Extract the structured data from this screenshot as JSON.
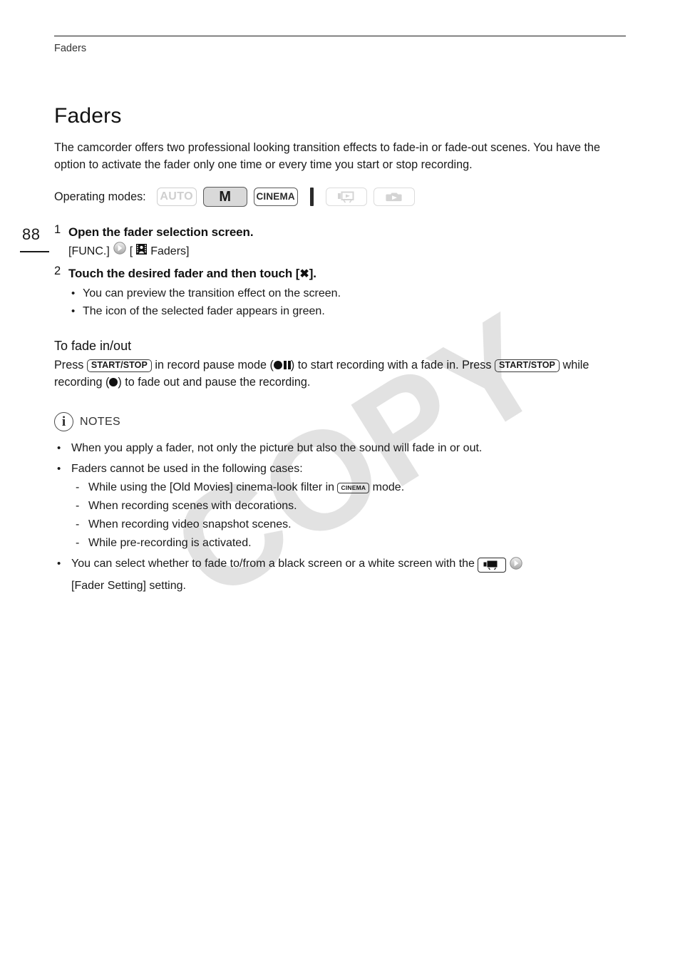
{
  "running_head": "Faders",
  "page_number": "88",
  "watermark": "COPY",
  "title": "Faders",
  "intro": "The camcorder offers two professional looking transition effects to fade-in or fade-out scenes. You have the option to activate the fader only one time or every time you start or stop recording.",
  "operating_modes": {
    "label": "Operating modes:",
    "badges": [
      {
        "id": "auto",
        "label": "AUTO",
        "state": "inactive"
      },
      {
        "id": "manual",
        "label": "M",
        "state": "active"
      },
      {
        "id": "cinema",
        "label": "CINEMA",
        "state": "available"
      },
      {
        "id": "movie-playback",
        "label": "",
        "icon": "movie-playback-icon",
        "state": "inactive"
      },
      {
        "id": "photo-playback",
        "label": "",
        "icon": "photo-playback-icon",
        "state": "inactive"
      }
    ]
  },
  "steps": [
    {
      "number": "1",
      "heading": "Open the fader selection screen.",
      "path_prefix": "[FUNC.]",
      "path_open": "[",
      "path_label": "Faders]",
      "bullets": []
    },
    {
      "number": "2",
      "heading_before": "Touch the desired fader and then touch [",
      "heading_glyph": "✖",
      "heading_after": "].",
      "bullets": [
        "You can preview the transition effect on the screen.",
        "The icon of the selected fader appears in green."
      ]
    }
  ],
  "fade_section": {
    "heading": "To fade in/out",
    "text_1": "Press",
    "key_1": "START/STOP",
    "text_2": "in record pause mode (",
    "text_3": ") to start recording with a fade in. Press",
    "key_2": "START/STOP",
    "text_4": "while recording (",
    "text_5": ") to fade out and pause the recording."
  },
  "notes": {
    "heading": "NOTES",
    "info_glyph": "i",
    "items": [
      {
        "text": "When you apply a fader, not only the picture but also the sound will fade in or out."
      },
      {
        "text": "Faders cannot be used in the following cases:",
        "sub_items": [
          {
            "before": "While using the [Old Movies] cinema-look filter in",
            "chip": "CINEMA",
            "after": "mode."
          },
          {
            "before": "When recording scenes with decorations.",
            "chip": "",
            "after": ""
          },
          {
            "before": "When recording video snapshot scenes.",
            "chip": "",
            "after": ""
          },
          {
            "before": "While pre-recording is activated.",
            "chip": "",
            "after": ""
          }
        ]
      },
      {
        "text_before": "You can select whether to fade to/from a black screen or a white screen with the",
        "text_after": "[Fader Setting] setting."
      }
    ]
  },
  "colors": {
    "text": "#1a1a1a",
    "muted": "#cfcfcf",
    "border_dark": "#5a5a5a",
    "active_fill": "#d9d9d9",
    "watermark": "#e2e2e2"
  }
}
